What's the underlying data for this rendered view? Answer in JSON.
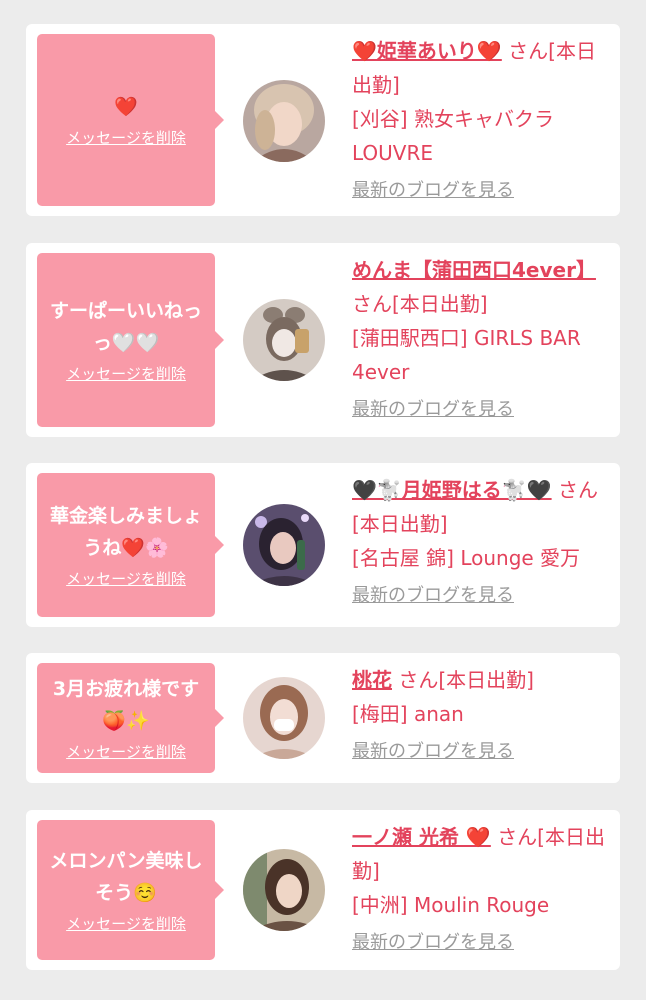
{
  "cards": [
    {
      "message": "❤️",
      "delete_label": "メッセージを削除",
      "name": "❤️姫華あいり❤️",
      "suffix": "さん[本日出勤]",
      "shop": "[刈谷] 熟女キャバクラ LOUVRE",
      "blog_label": "最新のブログを見る"
    },
    {
      "message": "すーぱーいいねっっ🤍🤍",
      "delete_label": "メッセージを削除",
      "name": "めんま【蒲田西口4ever】",
      "suffix": "さん[本日出勤]",
      "shop": "[蒲田駅西口] GIRLS BAR 4ever",
      "blog_label": "最新のブログを見る"
    },
    {
      "message": "華金楽しみましょうね❤️🌸",
      "delete_label": "メッセージを削除",
      "name": "🖤🐩月姫野はる🐩🖤",
      "suffix": "さん[本日出勤]",
      "shop": "[名古屋 錦] Lounge 愛万",
      "blog_label": "最新のブログを見る"
    },
    {
      "message": "3月お疲れ様です🍑✨",
      "delete_label": "メッセージを削除",
      "name": "桃花",
      "suffix": "さん[本日出勤]",
      "shop": "[梅田] anan",
      "blog_label": "最新のブログを見る"
    },
    {
      "message": "メロンパン美味しそう☺️",
      "delete_label": "メッセージを削除",
      "name": "一ノ瀬 光希 ❤️",
      "suffix": "さん[本日出勤]",
      "shop": "[中洲] Moulin Rouge",
      "blog_label": "最新のブログを見る"
    }
  ]
}
